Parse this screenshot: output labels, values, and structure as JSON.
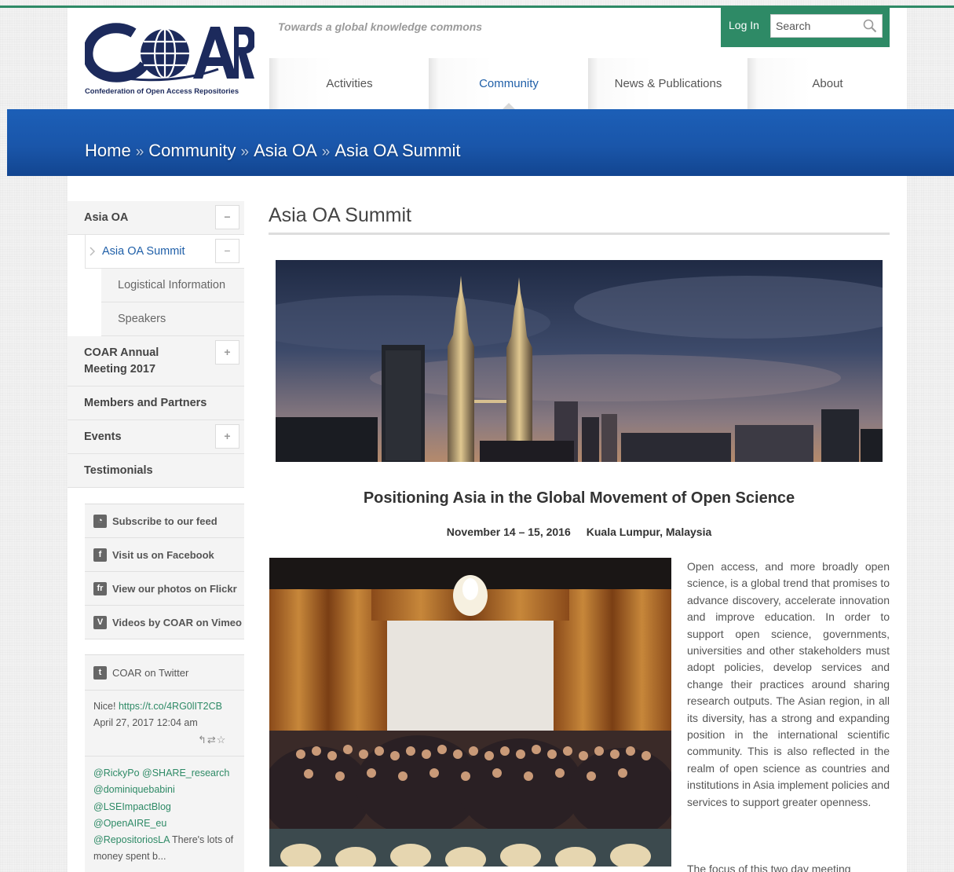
{
  "header": {
    "logo_text": "C●AR",
    "logo_subtitle": "Confederation of Open Access Repositories",
    "tagline": "Towards a global knowledge commons",
    "login_label": "Log In",
    "search_placeholder": "Search"
  },
  "nav": {
    "items": [
      {
        "label": "Activities"
      },
      {
        "label": "Community"
      },
      {
        "label": "News & Publications"
      },
      {
        "label": "About"
      }
    ],
    "active": "Community"
  },
  "breadcrumb": {
    "items": [
      "Home",
      "Community",
      "Asia OA",
      "Asia OA Summit"
    ],
    "separator": "»"
  },
  "sidebar": {
    "menu": [
      {
        "label": "Asia OA",
        "toggle": "−"
      },
      {
        "label": "Asia OA Summit",
        "toggle": "−"
      },
      {
        "label": "Logistical Information"
      },
      {
        "label": "Speakers"
      },
      {
        "label": "COAR Annual Meeting 2017",
        "toggle": "+"
      },
      {
        "label": "Members and Partners"
      },
      {
        "label": "Events",
        "toggle": "+"
      },
      {
        "label": "Testimonials"
      }
    ],
    "social": [
      {
        "label": "Subscribe to our feed",
        "icon": "rss-icon",
        "glyph": "◔"
      },
      {
        "label": "Visit us on Facebook",
        "icon": "facebook-icon",
        "glyph": "f"
      },
      {
        "label": "View our photos on Flickr",
        "icon": "flickr-icon",
        "glyph": "fr"
      },
      {
        "label": "Videos by COAR on Vimeo",
        "icon": "vimeo-icon",
        "glyph": "V"
      }
    ],
    "twitter": {
      "title": "COAR on Twitter",
      "tweet1_text": "Nice! ",
      "tweet1_link": "https://t.co/4RG0lIT2CB",
      "tweet1_date": "April 27, 2017 12:04 am",
      "tweet_actions": "↰⇄☆",
      "tweet2_mentions": [
        "@RickyPo",
        "@SHARE_research",
        "@dominiquebabini",
        "@LSEImpactBlog",
        "@OpenAIRE_eu",
        "@RepositoriosLA"
      ],
      "tweet2_text": " There's lots of money spent b..."
    }
  },
  "main": {
    "title": "Asia OA Summit",
    "heading": "Positioning Asia in the Global Movement of Open Science",
    "date": "November 14 – 15, 2016",
    "location": "Kuala Lumpur, Malaysia",
    "intro": "Open access, and more broadly open science, is a global trend that promises to advance discovery, accelerate innovation and improve education. In order to support open science, governments, universities and other stakeholders must adopt policies, develop services and change their practices around sharing research outputs. The Asian region, in all its diversity, has a strong and expanding position in the international scientific community. This is also reflected in the realm of open science as countries and institutions in Asia implement policies and services to support greater openness.",
    "intro2": "The focus of this two day meeting"
  },
  "colors": {
    "accent_green": "#2e8a66",
    "banner_blue": "#1a56aa",
    "logo_navy": "#1c2a5c",
    "link_blue": "#1f5fa8"
  }
}
